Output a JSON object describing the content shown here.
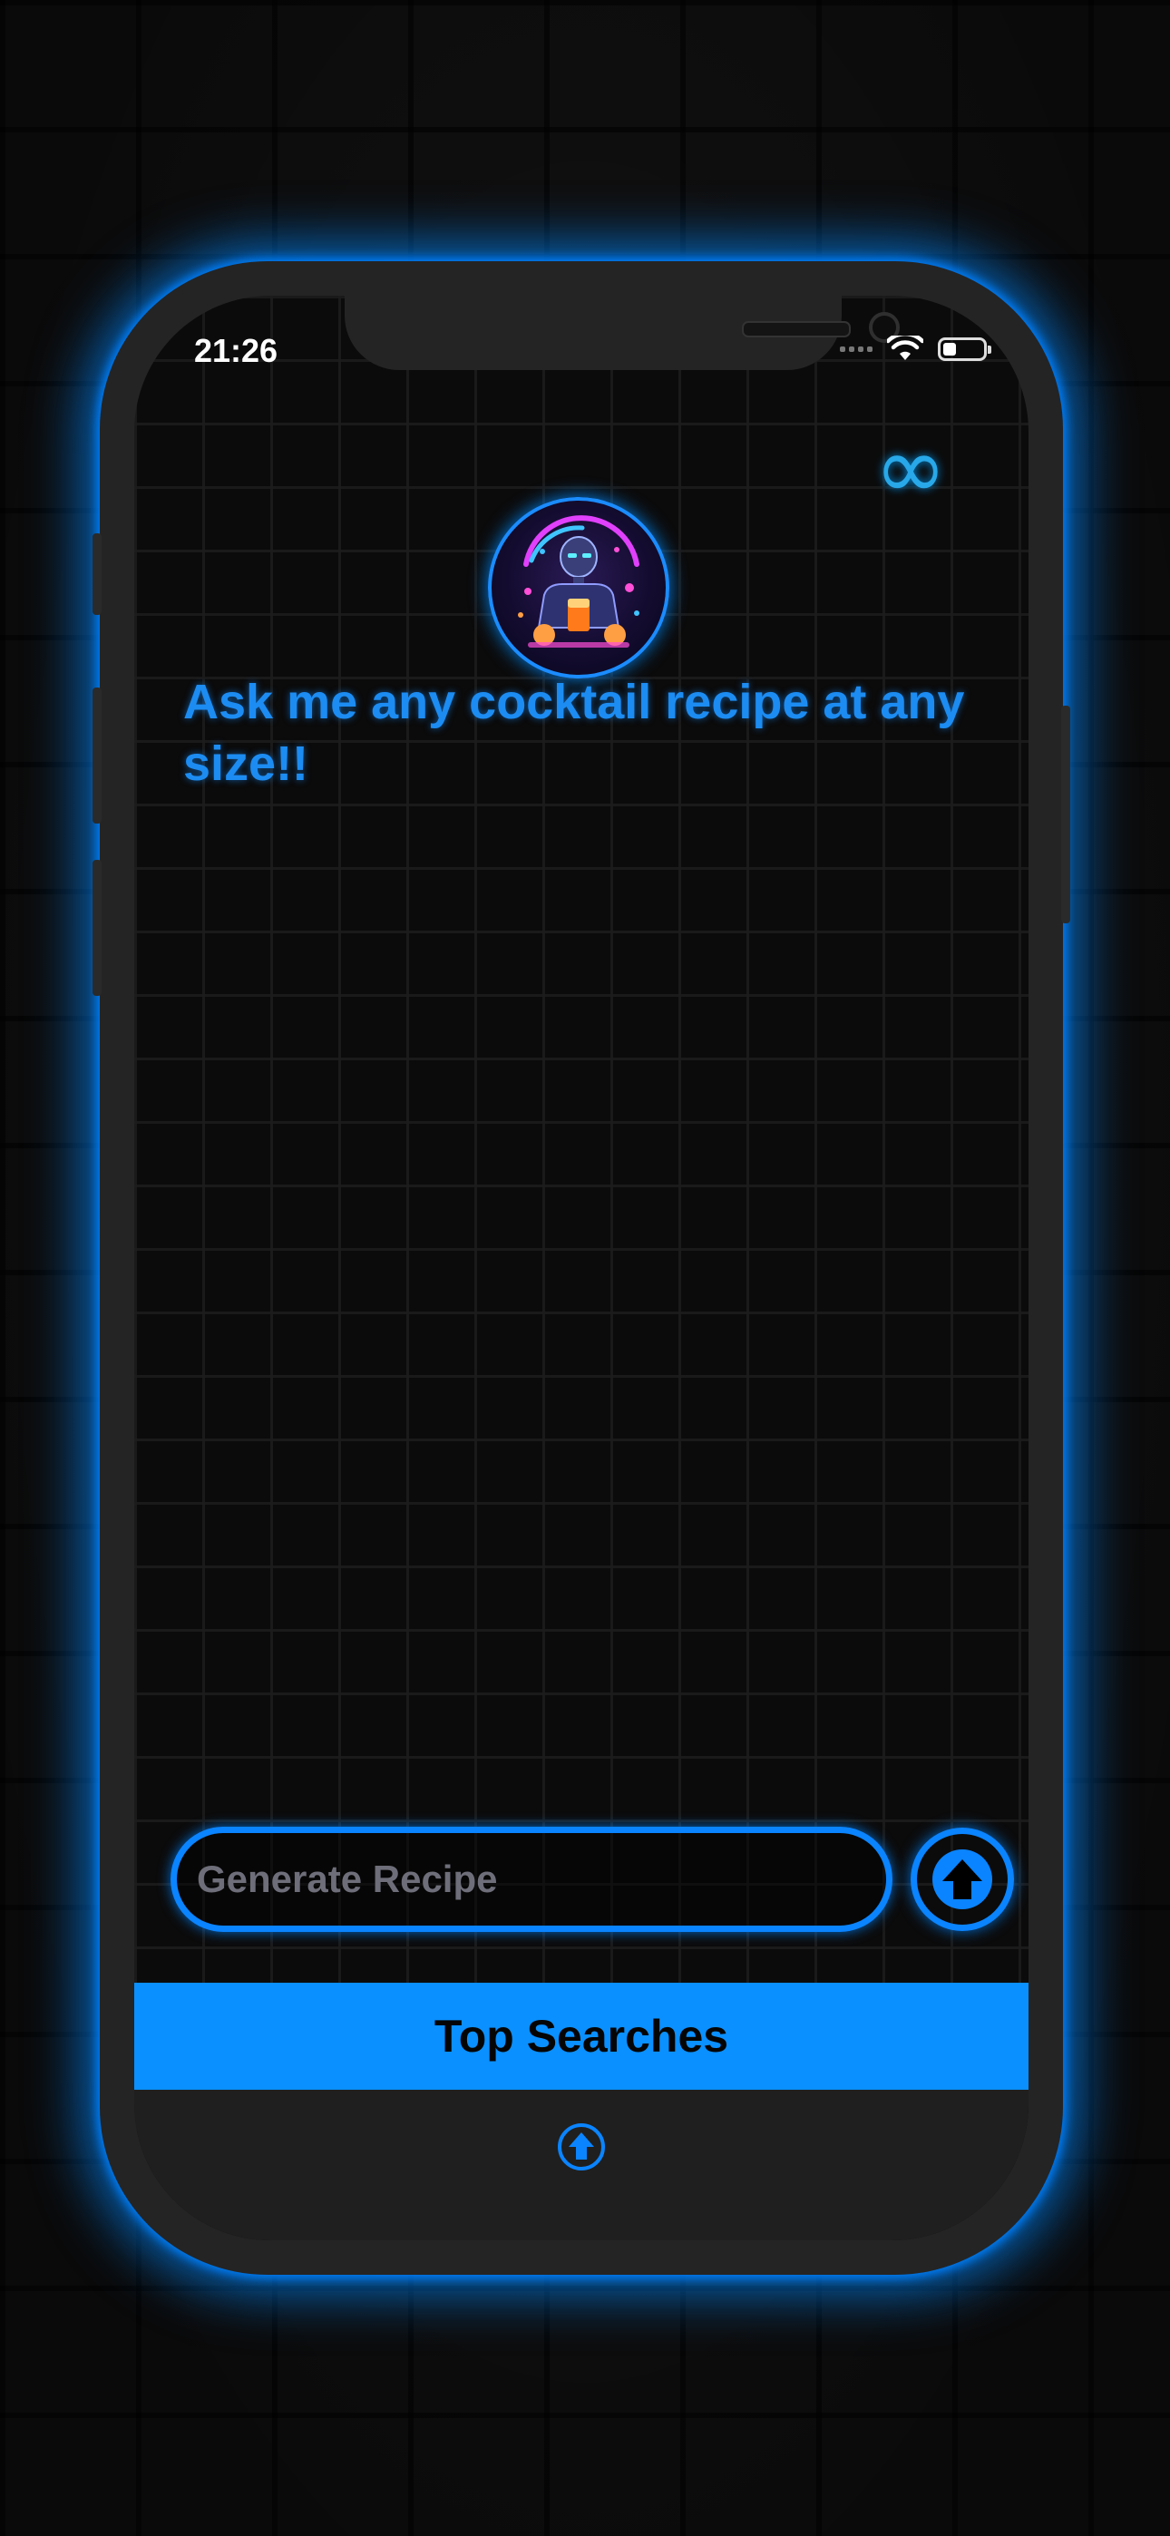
{
  "status_bar": {
    "time": "21:26"
  },
  "header": {
    "premium_icon": "infinity-icon",
    "premium_glyph": "∞",
    "avatar_icon": "robot-bartender-icon"
  },
  "main": {
    "headline": "Ask me any cocktail recipe at any size!!"
  },
  "composer": {
    "placeholder": "Generate Recipe",
    "send_icon": "arrow-up-circle-icon"
  },
  "bottom": {
    "top_searches_label": "Top Searches",
    "expand_icon": "arrow-up-circle-icon"
  },
  "colors": {
    "accent": "#0a84ff",
    "headline": "#1c8cf2",
    "infinity": "#28a8e8"
  }
}
